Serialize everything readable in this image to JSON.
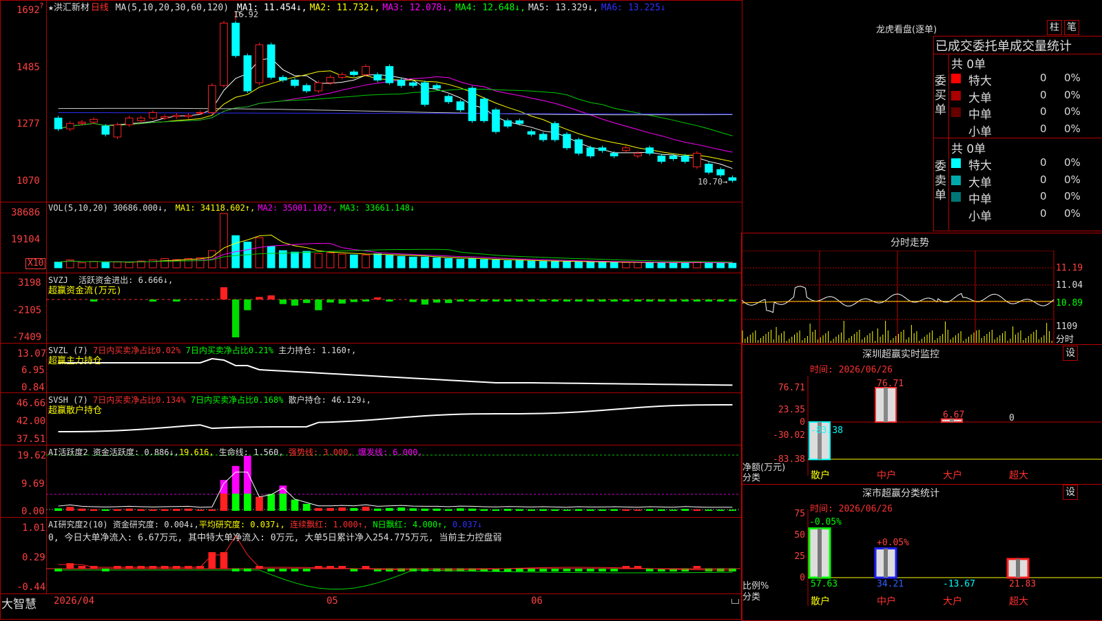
{
  "kline": {
    "stock_name": "★洪汇新材",
    "period": "日线",
    "ma_label": "MA(5,10,20,30,60,120)",
    "ma": [
      {
        "name": "MA1:",
        "value": "11.454↓,",
        "color": "#ffffff"
      },
      {
        "name": "MA2:",
        "value": "11.732↓,",
        "color": "#ffff00"
      },
      {
        "name": "MA3:",
        "value": "12.078↓,",
        "color": "#ff00ff"
      },
      {
        "name": "MA4:",
        "value": "12.648↓,",
        "color": "#00ff00"
      },
      {
        "name": "MA5:",
        "value": "13.329↓,",
        "color": "#dddddd"
      },
      {
        "name": "MA6:",
        "value": "13.225↓",
        "color": "#3030ff"
      }
    ],
    "y_ticks": [
      "1692",
      "1485",
      "1277",
      "1070"
    ],
    "high_label": "16.92",
    "low_label": "10.70→"
  },
  "vol": {
    "label": "VOL(5,10,20)",
    "value": "30686.000↓,",
    "ma": [
      {
        "name": "MA1:",
        "value": "34118.602↑,",
        "color": "#ffff00"
      },
      {
        "name": "MA2:",
        "value": "35001.102↑,",
        "color": "#ff00ff"
      },
      {
        "name": "MA3:",
        "value": "33661.148↓",
        "color": "#00ff00"
      }
    ],
    "y_ticks": [
      "38686",
      "19104"
    ],
    "unit_box": "X10"
  },
  "svzj": {
    "label": "SVZJ",
    "line1": "活跃资金进出: 6.666↓,",
    "line2": "超赢资金流(万元)",
    "y_ticks": [
      "3198",
      "-2105",
      "-7409"
    ]
  },
  "svzl": {
    "label": "SVZL (7)",
    "t1": "7日内买卖净占比0.02%",
    "t2": "7日内买卖净占比0.21%",
    "t3": "主力持仓: 1.160↑,",
    "line2": "超赢主力持仓",
    "y_ticks": [
      "13.07",
      "6.95",
      "0.84"
    ]
  },
  "svsh": {
    "label": "SVSH (7)",
    "t1": "7日内买卖净占比0.134%",
    "t2": "7日内买卖净占比0.168%",
    "t3": "散户持仓: 46.129↓,",
    "line2": "超赢散户持仓",
    "y_ticks": [
      "46.66",
      "42.00",
      "37.51"
    ]
  },
  "ai_active": {
    "label": "AI活跃度2",
    "t1": "资金活跃度: 0.886↓,",
    "t2": "19.616,",
    "t3": "生命线: 1.560,",
    "t4": "强势线: 3.000,",
    "t5": "爆发线: 6.000,",
    "y_ticks": [
      "19.62",
      "9.69",
      "0.00"
    ]
  },
  "ai_research": {
    "label": "AI研究度2(10)",
    "t1": "资金研究度: 0.004↓,",
    "t2": "平均研究度: 0.037↓,",
    "t3": "连续飘红: 1.000↑,",
    "t4": "N日飘红: 4.000↑,",
    "t5": "0.037↓",
    "summary": "0, 今日大单净流入: 6.67万元, 其中特大单净流入: 0万元, 大单5日累计净入254.775万元, 当前主力控盘弱",
    "y_ticks": [
      "1.01",
      "0.29",
      "-0.44"
    ]
  },
  "bottom": {
    "brand": "大智慧",
    "dates": [
      "2026/04",
      "05",
      "06"
    ]
  },
  "dragon_tiger": {
    "title": "龙虎看盘(逐单)",
    "btn_bar": "柱",
    "btn_stroke": "笔",
    "subtitle": "已成交委托单成交量统计",
    "buy_label": "委买单",
    "sell_label": "委卖单",
    "buy_total": "共 0单",
    "sell_total": "共 0单",
    "buy_rows": [
      {
        "name": "特大",
        "count": "0",
        "pct": "0%",
        "color": "#ff0000"
      },
      {
        "name": "大单",
        "count": "0",
        "pct": "0%",
        "color": "#aa0000"
      },
      {
        "name": "中单",
        "count": "0",
        "pct": "0%",
        "color": "#660000"
      },
      {
        "name": "小单",
        "count": "0",
        "pct": "0%",
        "color": ""
      }
    ],
    "sell_rows": [
      {
        "name": "特大",
        "count": "0",
        "pct": "0%",
        "color": "#00ffff"
      },
      {
        "name": "大单",
        "count": "0",
        "pct": "0%",
        "color": "#00aaaa"
      },
      {
        "name": "中单",
        "count": "0",
        "pct": "0%",
        "color": "#007777"
      },
      {
        "name": "小单",
        "count": "0",
        "pct": "0%",
        "color": ""
      }
    ]
  },
  "intraday": {
    "title": "分时走势",
    "prices": [
      "11.19",
      "11.04",
      "10.89"
    ],
    "vol": "1109",
    "vol_unit": "分时"
  },
  "sz_monitor": {
    "title": "深圳超赢实时监控",
    "set_btn": "设",
    "time": "时间: 2026/06/26",
    "y_ticks": [
      "76.71",
      "23.35",
      "0",
      "-30.02",
      "-83.38"
    ],
    "values": [
      "-83.38",
      "76.71",
      "6.67",
      "0"
    ],
    "categories": [
      "散户",
      "中户",
      "大户",
      "超大"
    ],
    "axis_title": "净额(万元)",
    "axis_sub": "分类"
  },
  "sz_class": {
    "title": "深市超赢分类统计",
    "set_btn": "设",
    "time": "时间: 2026/06/26",
    "y_ticks": [
      "75",
      "50",
      "25",
      "0"
    ],
    "top_labels": [
      "-0.05%",
      "+0.05%"
    ],
    "bottom_values": [
      "57.63",
      "34.21",
      "-13.67",
      "21.83"
    ],
    "categories": [
      "散户",
      "中户",
      "大户",
      "超大"
    ],
    "axis_title": "比例%",
    "axis_sub": "分类"
  },
  "chart_data": [
    {
      "type": "candlestick",
      "title": "★洪汇新材 日线",
      "ylim": [
        10.7,
        16.92
      ],
      "open": [
        13.0,
        12.6,
        12.8,
        12.85,
        12.7,
        12.3,
        12.75,
        12.9,
        13.0,
        13.0,
        13.05,
        13.05,
        13.2,
        13.2,
        14.2,
        16.5,
        15.3,
        14.3,
        15.7,
        14.5,
        14.4,
        14.2,
        14.0,
        14.3,
        14.5,
        14.7,
        14.6,
        14.6,
        14.9,
        14.4,
        14.3,
        14.3,
        14.2,
        13.8,
        13.6,
        14.1,
        13.7,
        13.3,
        12.9,
        12.9,
        12.5,
        12.4,
        12.8,
        12.4,
        12.2,
        11.9,
        11.9,
        11.7,
        11.8,
        11.6,
        11.9,
        11.6,
        11.6,
        11.6,
        11.2,
        11.3,
        11.1,
        10.8
      ],
      "close": [
        12.6,
        12.8,
        12.85,
        12.95,
        12.4,
        12.75,
        13.0,
        13.0,
        13.2,
        13.05,
        13.1,
        13.1,
        13.2,
        14.2,
        16.5,
        15.3,
        14.0,
        15.7,
        14.5,
        14.4,
        14.2,
        14.0,
        14.3,
        14.5,
        14.6,
        14.6,
        14.9,
        14.4,
        14.3,
        14.2,
        14.2,
        13.5,
        14.1,
        13.6,
        13.3,
        12.9,
        12.9,
        12.5,
        12.7,
        12.8,
        12.4,
        12.2,
        12.2,
        11.9,
        11.7,
        11.6,
        11.8,
        11.6,
        11.9,
        11.7,
        11.7,
        11.4,
        11.5,
        11.4,
        11.7,
        11.0,
        10.9,
        10.7
      ],
      "high": 16.92,
      "low": 10.7
    },
    {
      "type": "bar",
      "title": "VOL(5,10,20)",
      "values": [
        800,
        1100,
        700,
        900,
        750,
        800,
        780,
        950,
        1100,
        1300,
        1150,
        1300,
        1400,
        2400,
        7600,
        4500,
        3600,
        4200,
        3000,
        2400,
        2200,
        2300,
        2000,
        2100,
        1900,
        1800,
        1800,
        1950,
        1750,
        1600,
        1500,
        1500,
        1400,
        1300,
        1200,
        1250,
        1150,
        1100,
        1000,
        1000,
        950,
        900,
        900,
        850,
        820,
        800,
        790,
        760,
        750,
        760,
        740,
        700,
        720,
        700,
        760,
        700,
        680,
        650
      ]
    },
    {
      "type": "bar",
      "title": "深圳超赢实时监控",
      "categories": [
        "散户",
        "中户",
        "大户",
        "超大"
      ],
      "values": [
        -83.38,
        76.71,
        6.67,
        0
      ],
      "ylim": [
        -83.38,
        76.71
      ]
    },
    {
      "type": "bar",
      "title": "深市超赢分类统计",
      "categories": [
        "散户",
        "中户",
        "大户",
        "超大"
      ],
      "values": [
        57.63,
        34.21,
        -13.67,
        21.83
      ],
      "ylim": [
        0,
        75
      ]
    }
  ]
}
